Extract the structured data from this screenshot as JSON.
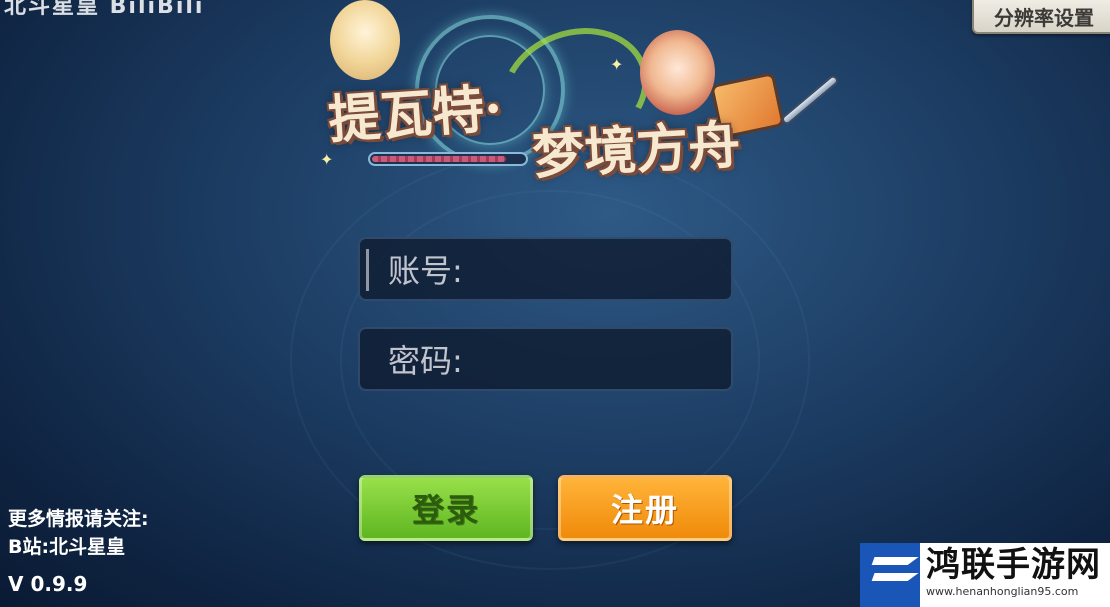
{
  "top_left_text": "北斗星皇 BiliBili",
  "resolution_button_label": "分辨率设置",
  "logo": {
    "line1": "提瓦特·",
    "line2": "梦境方舟"
  },
  "login_form": {
    "account_label": "账号:",
    "password_label": "密码:"
  },
  "buttons": {
    "login_label": "登录",
    "register_label": "注册"
  },
  "info": {
    "follow_text": "更多情报请关注:",
    "bilibili_text": "B站:北斗星皇",
    "version": "V 0.9.9"
  },
  "watermark": {
    "title": "鸿联手游网",
    "url": "www.henanhonglian95.com"
  },
  "colors": {
    "login_button": "#7ccc35",
    "register_button": "#f8a020",
    "background": "#1c3c62"
  }
}
